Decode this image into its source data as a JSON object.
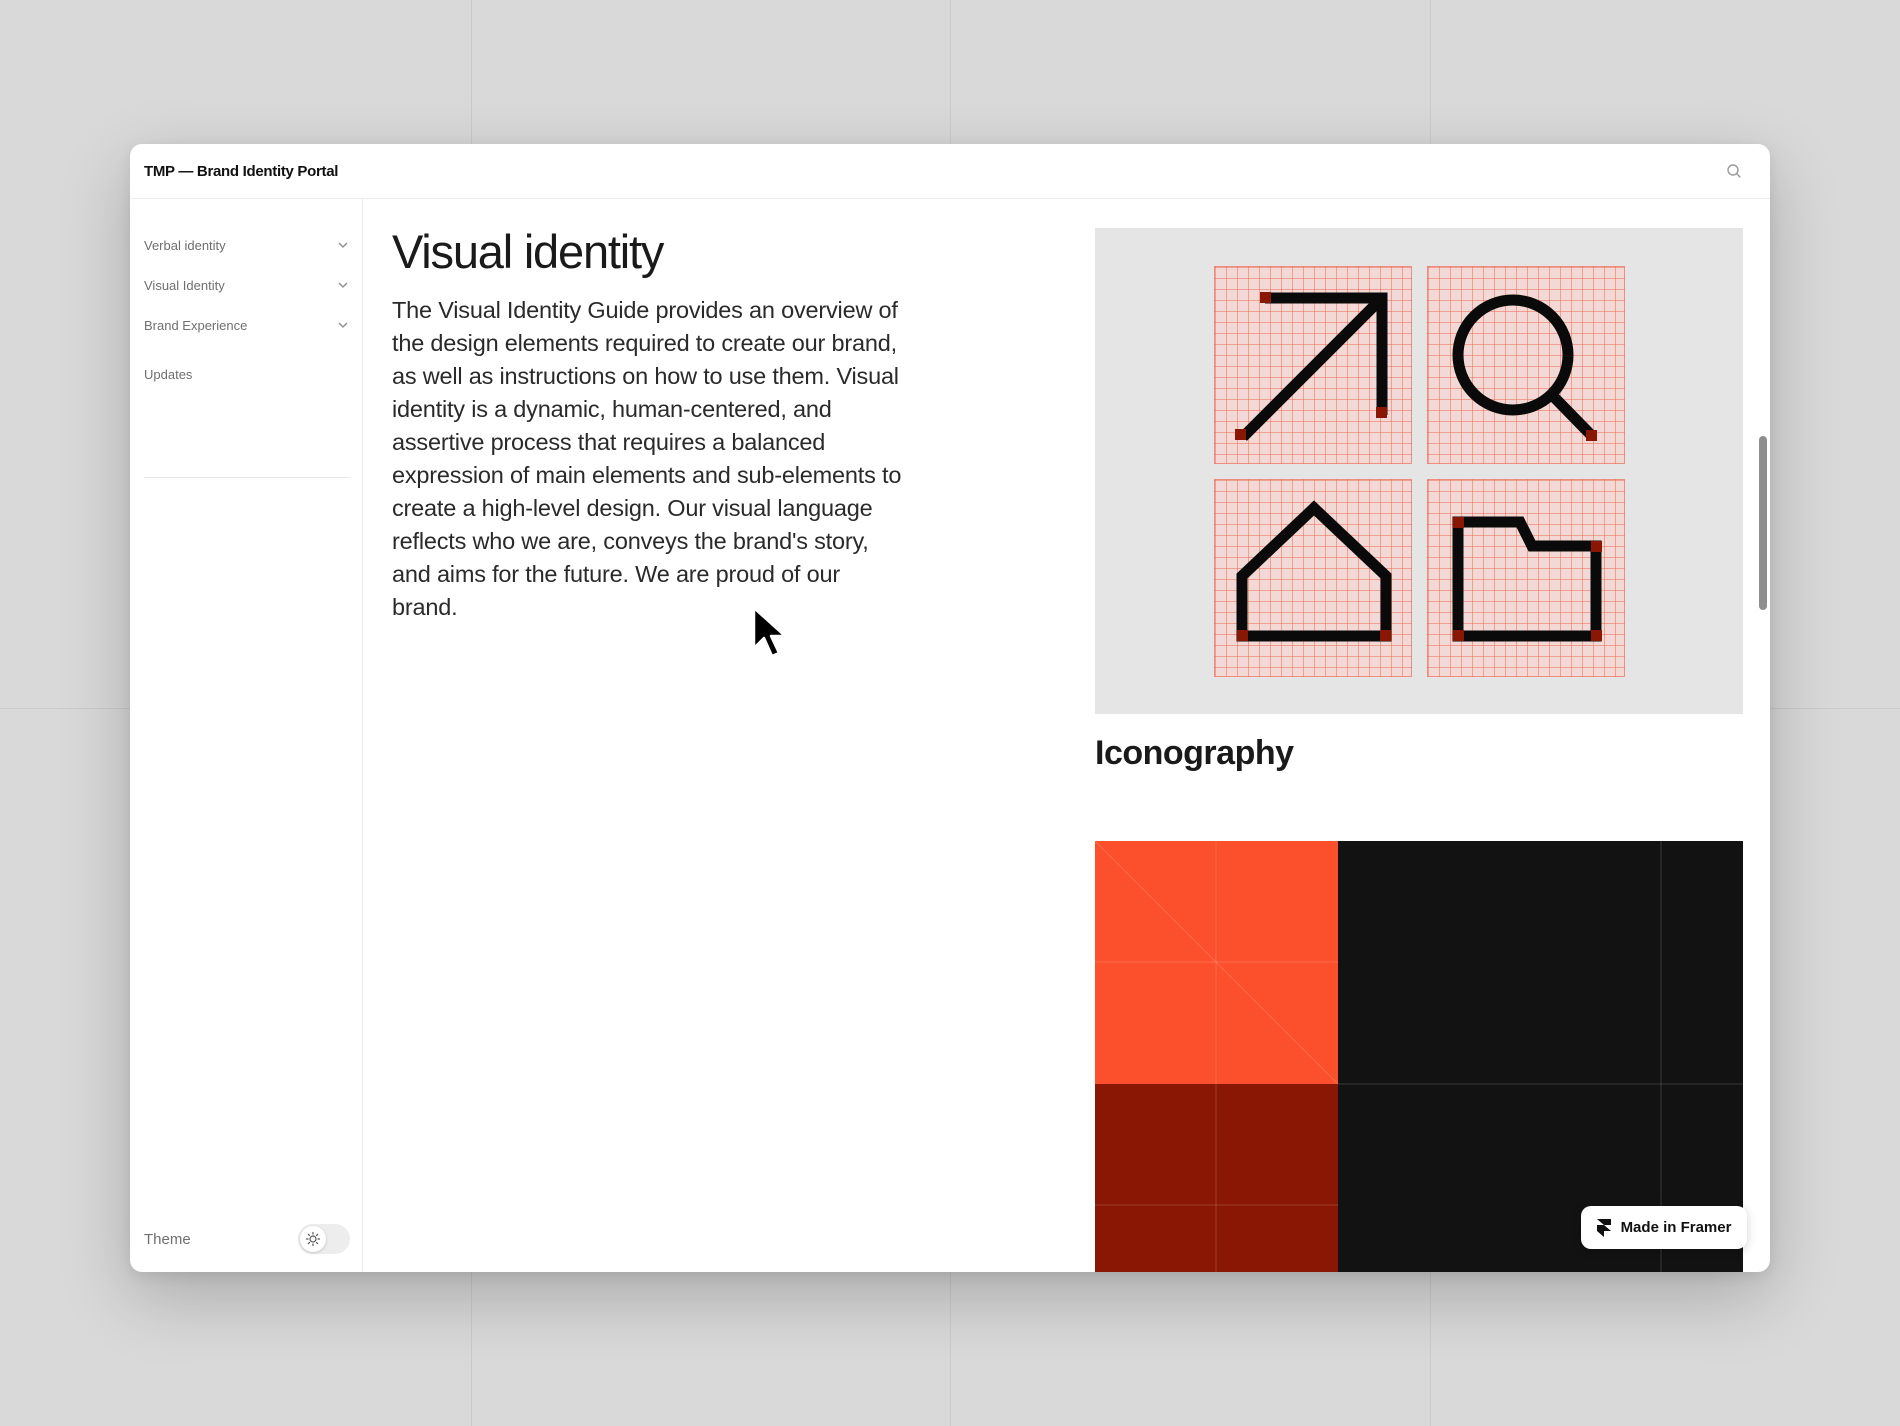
{
  "window": {
    "app_title": "TMP — Brand Identity Portal"
  },
  "sidebar": {
    "items": [
      {
        "label": "Verbal identity",
        "icon": "chevron-down-icon"
      },
      {
        "label": "Visual Identity",
        "icon": "chevron-down-icon"
      },
      {
        "label": "Brand Experience",
        "icon": "chevron-down-icon"
      },
      {
        "label": "Updates"
      }
    ],
    "theme_label": "Theme",
    "theme_icon": "sun-icon"
  },
  "main": {
    "title": "Visual identity",
    "body": "The Visual Identity Guide provides an overview of the design elements required to create our brand, as well as instructions on how to use them. Visual identity is a dynamic, human-centered, and assertive process that requires a balanced expression of main elements and sub-elements to create a high-level design. Our visual language reflects who we are, conveys the brand's story, and aims for the future. We are proud of our brand."
  },
  "cards": {
    "iconography": {
      "title": "Iconography",
      "icons": [
        "arrow-up-right-icon",
        "search-icon",
        "home-icon",
        "folder-icon"
      ]
    },
    "colors": {
      "swatches": [
        "#FC4F2C",
        "#8A1703",
        "#121212"
      ]
    }
  },
  "badge": {
    "label": "Made in Framer",
    "icon": "framer-logo-icon"
  },
  "colors": {
    "accent": "#FC4F2C",
    "dark_red": "#8A1703",
    "black": "#121212"
  }
}
